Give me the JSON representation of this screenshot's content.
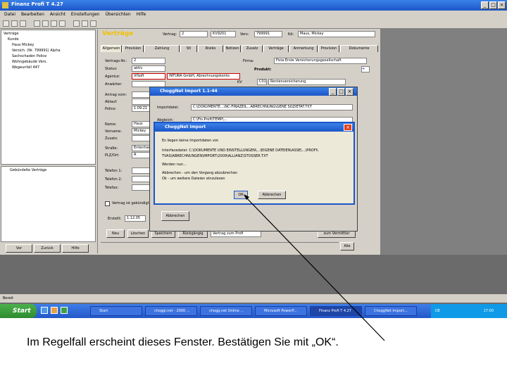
{
  "window": {
    "title": "Finanz Profi T 4.27",
    "menu": [
      "Datei",
      "Bearbeiten",
      "Ansicht",
      "Einstellungen",
      "Übersichten",
      "Hilfe"
    ]
  },
  "tree": {
    "items": [
      "Verträge",
      "Kunde",
      "Haus Mickey",
      "Versich. (Nr. 799991) Alpha",
      "Sachschaden Police",
      "Wohngebäude Vers.",
      "Wegeunfall 447"
    ],
    "bottom_item": "Gebündelte Verträge",
    "buttons": [
      "Vor",
      "Zurück",
      "Hilfe"
    ]
  },
  "header": {
    "section_title": "Verträge",
    "vertrag_label": "Vertrag:",
    "vertrag_value": "2",
    "kv_value": "KV9201",
    "vers_label": "Vers:",
    "vers_value": "799991",
    "kd_label": "Kd:",
    "kd_value": "Maus, Mickey"
  },
  "tabs": [
    "Allgemein",
    "Provision",
    "Zahlung",
    "Stl",
    "Risiko",
    "Notizen",
    "Zusatz",
    "Verträge",
    "Anmerkung",
    "Provision",
    "Dokumente"
  ],
  "form": {
    "fields": [
      {
        "label": "Vertrags-Nr.:",
        "value": "2"
      },
      {
        "label": "Status:",
        "value": "aktiv"
      },
      {
        "label": "Agentur:",
        "value": "ViSoft"
      },
      {
        "label": "Anwärter:",
        "value": ""
      },
      {
        "label": "Antrag vom:",
        "value": ""
      },
      {
        "label": "Ablauf:",
        "value": ""
      },
      {
        "label": "Police:",
        "value": "1.09.21"
      },
      {
        "label": "Name:",
        "value": "Haus"
      },
      {
        "label": "Vorname:",
        "value": "Mickey"
      },
      {
        "label": "Zusatz:",
        "value": ""
      },
      {
        "label": "Straße:",
        "value": "Entenhausen"
      },
      {
        "label": "PLZ/Ort:",
        "value": "A"
      },
      {
        "label": "Telefon 1:",
        "value": ""
      },
      {
        "label": "Telefon 2:",
        "value": ""
      },
      {
        "label": "Telefax:",
        "value": ""
      }
    ],
    "agentur_value": "INTURA GmbH, Abrechnungskonto",
    "firma_label": "Firma:",
    "firma_value": "Fivia Erste Versicherungsgesellschaft",
    "produkt_label": "Produkt:",
    "produkt_value": "Rentenversicherung",
    "kv_label": "KV",
    "kv_code": "C01",
    "checkbox_label": "Vertrag ist gekündigt",
    "erstellt_label": "Erstellt:",
    "erstellt_value": "1.12.05"
  },
  "bottom_buttons": [
    "Neu",
    "Löschen",
    "Speichern",
    "Rückgängig",
    "Vertrag zum Profi",
    "zum Vermittler"
  ],
  "alle_label": "Alle",
  "dialog1": {
    "title": "ChoggNet Import 1.1-44",
    "rows": [
      {
        "label": "Importdatei:",
        "value": "C:\\DOKUMENTE...\\NC-FINAZEIL...ABRECHNUNG\\GENE SOZIETÄT.TXT"
      },
      {
        "label": "Abgleich:",
        "value": "C:\\Fin.Profi\\TEMP\\..."
      }
    ],
    "abbrechen": "Abbrechen"
  },
  "dialog2": {
    "title": "ChoggNet Import",
    "lines": [
      "Es liegen keine Importdaten vor.",
      "Interfacedatei: C:\\DOKUMENTE UND EINSTELLUNGEN\\...\\EIGENE DATEIEN\\ASSE\\...\\PROFI\\",
      "TVAS\\ABRECHNUNGEN\\IMPORT\\2009\\ALLIANZ\\STOSSER.TXT",
      "Werden nun...",
      "Abbrechen - um den Vorgang abzubrechen",
      "Ok - um weitere Dateien einzulesen"
    ],
    "ok": "OK",
    "cancel": "Abbrechen"
  },
  "statusbar": "Bereit",
  "taskbar": {
    "start": "Start",
    "tasks": [
      "Start",
      "choggi.net - 2000 ...",
      "chogg.net Online ...",
      "Microsoft PowerP...",
      "Finanz Profi T 4.27",
      "ChoggNet Import..."
    ],
    "tray_lang": "DE",
    "tray_time": "17:00"
  },
  "caption": "Im Regelfall erscheint dieses Fenster. Bestätigen Sie mit „OK“."
}
